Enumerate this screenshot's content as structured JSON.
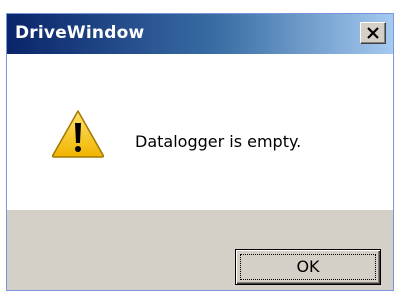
{
  "window": {
    "title": "DriveWindow",
    "close_icon": "close-icon"
  },
  "message": {
    "icon": "warning-icon",
    "text": "Datalogger is empty."
  },
  "buttons": {
    "ok_label": "OK"
  },
  "colors": {
    "titlebar_start": "#0a246a",
    "titlebar_end": "#a6caf0",
    "dialog_face": "#d4d0c8",
    "warning_fill": "#f5c400"
  }
}
